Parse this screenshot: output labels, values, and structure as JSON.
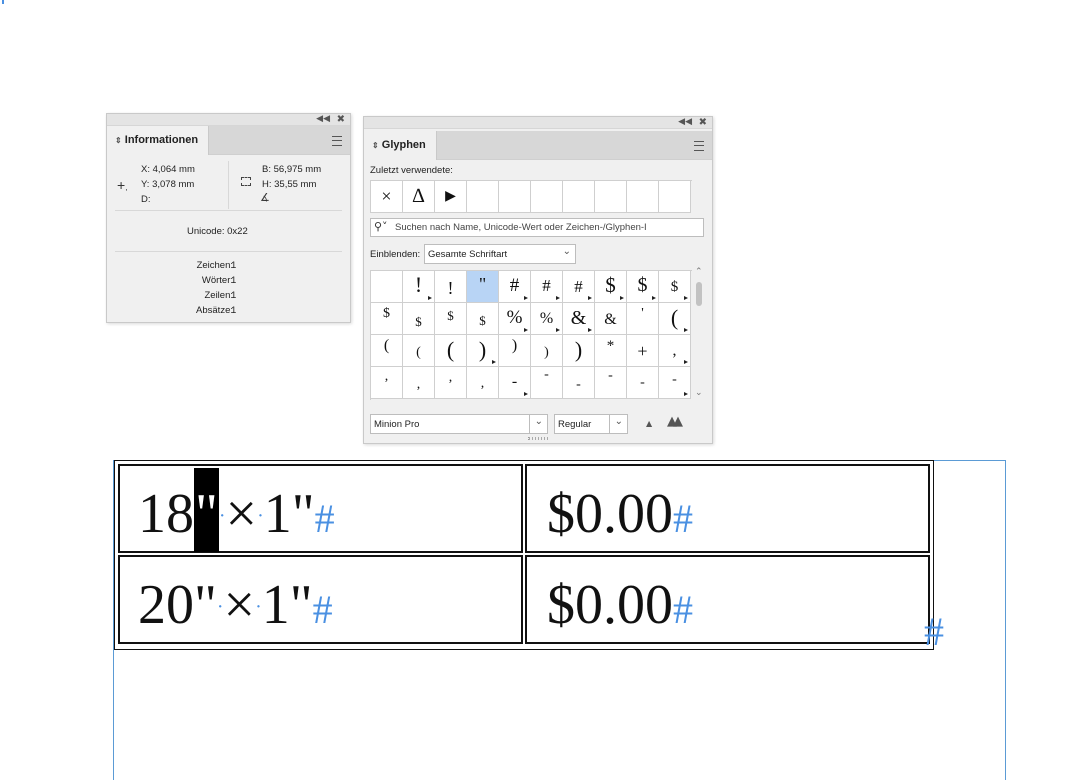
{
  "info_panel": {
    "tab": "Informationen",
    "x": "X: 4,064 mm",
    "y": "Y: 3,078 mm",
    "d": "D:",
    "b": "B: 56,975 mm",
    "h": "H: 35,55 mm",
    "unicode": "Unicode: 0x22",
    "stats": [
      {
        "label": "Zeichen:",
        "value": "1"
      },
      {
        "label": "Wörter:",
        "value": "1"
      },
      {
        "label": "Zeilen:",
        "value": "1"
      },
      {
        "label": "Absätze:",
        "value": "1"
      }
    ]
  },
  "glyph_panel": {
    "tab": "Glyphen",
    "recent_label": "Zuletzt verwendete:",
    "recent": [
      "×",
      "∆",
      "▶",
      "",
      "",
      "",
      "",
      "",
      "",
      ""
    ],
    "search_placeholder": "Suchen nach Name, Unicode-Wert oder Zeichen-/Glyphen-I",
    "show_label": "Einblenden:",
    "show_value": "Gesamte Schriftart",
    "glyph_rows": [
      [
        "",
        "!",
        "!",
        "\"",
        "#",
        "#",
        "#",
        "$",
        "$",
        "$"
      ],
      [
        "$",
        "$",
        "$",
        "$",
        "%",
        "%",
        "&",
        "&",
        "'",
        "("
      ],
      [
        "(",
        "(",
        "(",
        ")",
        ")",
        ")",
        ")",
        "*",
        "+",
        ","
      ],
      [
        ",",
        ",",
        ",",
        ",",
        "-",
        "-",
        "-",
        "-",
        "-",
        "-"
      ]
    ],
    "font_family": "Minion Pro",
    "font_style": "Regular"
  },
  "table": {
    "rows": [
      {
        "size_a": "18",
        "selected_char": "\"",
        "times": "×",
        "size_b": "1\"",
        "hash": "#",
        "price": "$0.00",
        "price_hash": "#"
      },
      {
        "size_a": "20\"",
        "selected_char": "",
        "times": "×",
        "size_b": "1\"",
        "hash": "#",
        "price": "$0.00",
        "price_hash": "#"
      }
    ],
    "end_hash": "#"
  },
  "colors": {
    "accent": "#4a90e2",
    "selected_glyph": "#b8d4f5",
    "frame": "#5b9bd5"
  }
}
